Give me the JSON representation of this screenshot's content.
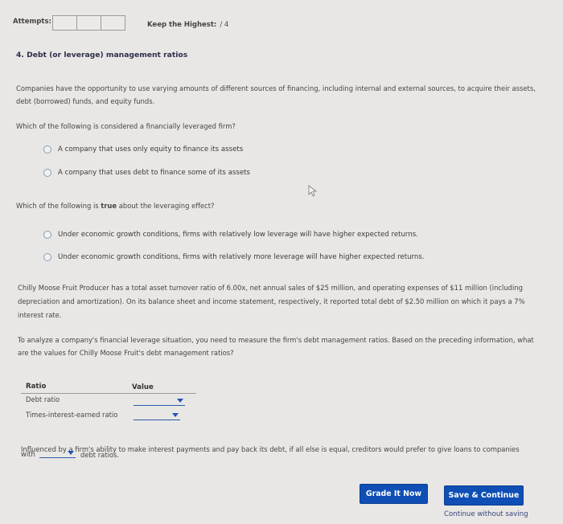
{
  "header": {
    "attempts_label": "Attempts:",
    "keep_label": "Keep the Highest:",
    "score": "/ 4"
  },
  "section": {
    "title": "4. Debt (or leverage) management ratios",
    "intro": "Companies have the opportunity to use varying amounts of different sources of financing, including internal and external sources, to acquire their assets, debt (borrowed) funds, and equity funds."
  },
  "q1": {
    "prompt": "Which of the following is considered a financially leveraged firm?",
    "options": [
      "A company that uses only equity to finance its assets",
      "A company that uses debt to finance some of its assets"
    ]
  },
  "q2": {
    "prompt_before": "Which of the following is ",
    "prompt_bold": "true",
    "prompt_after": " about the leveraging effect?",
    "options": [
      "Under economic growth conditions, firms with relatively low leverage will have higher expected returns.",
      "Under economic growth conditions, firms with relatively more leverage will have higher expected returns."
    ]
  },
  "scenario": "Chilly Moose Fruit Producer has a total asset turnover ratio of 6.00x, net annual sales of $25 million, and operating expenses of $11 million (including depreciation and amortization). On its balance sheet and income statement, respectively, it reported total debt of $2.50 million on which it pays a 7% interest rate.",
  "analyze": "To analyze a company's financial leverage situation, you need to measure the firm's debt management ratios. Based on the preceding information, what are the values for Chilly Moose Fruit's debt management ratios?",
  "table": {
    "headers": [
      "Ratio",
      "Value"
    ],
    "rows": [
      {
        "ratio": "Debt ratio",
        "value": ""
      },
      {
        "ratio": "Times-interest-earned ratio",
        "value": ""
      }
    ]
  },
  "q3": {
    "before": "Influenced by a firm's ability to make interest payments and pay back its debt, if all else is equal, creditors would prefer to give loans to companies",
    "with": "with",
    "selected": "",
    "after": "debt ratios."
  },
  "actions": {
    "grade": "Grade It Now",
    "save": "Save & Continue",
    "continue_without": "Continue without saving"
  }
}
